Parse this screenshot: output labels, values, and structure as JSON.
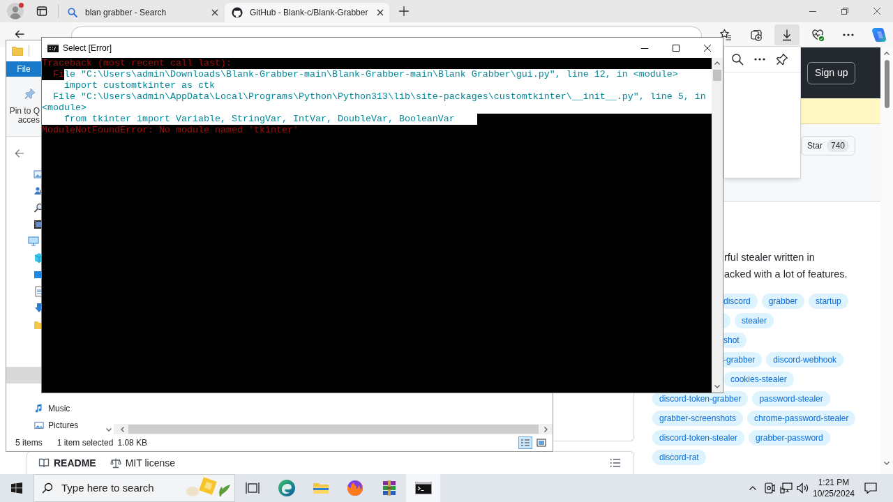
{
  "browser": {
    "tabs": [
      {
        "label": "blan grabber - Search",
        "kind": "search",
        "selected": false
      },
      {
        "label": "GitHub - Blank-c/Blank-Grabber",
        "kind": "github",
        "selected": true
      }
    ],
    "toolbar_buttons": [
      {
        "kind": "favorites",
        "selected": false
      },
      {
        "kind": "collections",
        "selected": false
      },
      {
        "kind": "downloads",
        "selected": true
      },
      {
        "kind": "health",
        "selected": false
      },
      {
        "kind": "more",
        "selected": false
      },
      {
        "kind": "copilot",
        "selected": false
      }
    ]
  },
  "github": {
    "sign_up": "Sign up",
    "star": {
      "label": "Star",
      "count": "740"
    },
    "description_lines": [
      "rful stealer written in",
      "acked with a lot of features."
    ],
    "topic_rows": [
      [
        {
          "kind": "cut",
          "label": "discord"
        },
        {
          "kind": "full",
          "label": "grabber"
        },
        {
          "kind": "full",
          "label": "startup"
        }
      ],
      [
        {
          "kind": "stub"
        },
        {
          "kind": "full",
          "label": "stealer"
        }
      ],
      [
        {
          "kind": "cut",
          "label": "shot"
        }
      ],
      [
        {
          "kind": "cut",
          "label": "-grabber"
        },
        {
          "kind": "full",
          "label": "discord-webhook"
        }
      ],
      [
        {
          "kind": "full",
          "label": "cookies-stealer"
        }
      ],
      [
        {
          "kind": "full",
          "label": "discord-token-grabber"
        },
        {
          "kind": "full",
          "label": "password-stealer"
        }
      ],
      [
        {
          "kind": "full",
          "label": "grabber-screenshots"
        },
        {
          "kind": "full",
          "label": "chrome-password-stealer"
        }
      ],
      [
        {
          "kind": "full",
          "label": "discord-token-stealer"
        },
        {
          "kind": "full",
          "label": "grabber-password"
        }
      ],
      [
        {
          "kind": "full",
          "label": "discord-rat"
        }
      ]
    ],
    "readme_tabs": [
      {
        "kind": "book",
        "label": "README",
        "selected": true
      },
      {
        "kind": "law",
        "label": "MIT license",
        "selected": false
      }
    ]
  },
  "explorer": {
    "ribbon_tab": "File",
    "pin_button_lines": [
      "Pin to Q",
      "acces"
    ],
    "nav_items": [
      {
        "kind": "image",
        "selected": false
      },
      {
        "kind": "user",
        "selected": false
      },
      {
        "kind": "search",
        "selected": false
      },
      {
        "kind": "video",
        "selected": false
      },
      {
        "kind": "computer",
        "selected": false
      },
      {
        "kind": "cube",
        "selected": false
      },
      {
        "kind": "desktop",
        "selected": false
      },
      {
        "kind": "document",
        "selected": false
      },
      {
        "kind": "download",
        "selected": false
      },
      {
        "kind": "folder",
        "selected": false
      },
      {
        "kind": "row",
        "selected": true
      },
      {
        "kind": "music",
        "label": "Music",
        "selected": false
      },
      {
        "kind": "pictures",
        "label": "Pictures",
        "selected": false
      }
    ],
    "status": [
      "5 items",
      "1 item selected",
      "1.08 KB"
    ],
    "views": [
      {
        "kind": "details",
        "selected": true
      },
      {
        "kind": "thumbnails",
        "selected": false
      }
    ]
  },
  "console": {
    "title": "Select [Error]",
    "lines": [
      {
        "segments": [
          {
            "text": "Traceback (most recent call last):",
            "selected": false
          }
        ]
      },
      {
        "segments": [
          {
            "text": "  Fi",
            "selected": false
          },
          {
            "text": "le \"C:\\Users\\admin\\Downloads\\Blank-Grabber-main\\Blank-Grabber-main\\Blank Grabber\\gui.py\", line 12, in <module>",
            "selected": true
          }
        ]
      },
      {
        "segments": [
          {
            "text": "    import customtkinter as ctk",
            "selected": true
          }
        ]
      },
      {
        "segments": [
          {
            "text": "  File \"C:\\Users\\admin\\AppData\\Local\\Programs\\Python\\Python313\\lib\\site-packages\\customtkinter\\__init__.py\", line 5, in",
            "selected": true
          }
        ]
      },
      {
        "segments": [
          {
            "text": "<module>",
            "selected": true
          }
        ]
      },
      {
        "segments": [
          {
            "text": "    from tkinter import Variable, StringVar, IntVar, DoubleVar, BooleanVar    ",
            "selected": true
          }
        ]
      },
      {
        "segments": [
          {
            "text": "ModuleNotFoundError: No module named 'tkinter'",
            "selected": false
          }
        ]
      }
    ]
  },
  "taskbar": {
    "search_placeholder": "Type here to search",
    "apps": [
      {
        "kind": "taskview",
        "selected": false
      },
      {
        "kind": "edge",
        "selected": false
      },
      {
        "kind": "folder",
        "selected": false
      },
      {
        "kind": "firefox",
        "selected": false
      },
      {
        "kind": "archive",
        "selected": false
      },
      {
        "kind": "terminal",
        "selected": true
      }
    ],
    "time": "1:21 PM",
    "date": "10/25/2024"
  }
}
